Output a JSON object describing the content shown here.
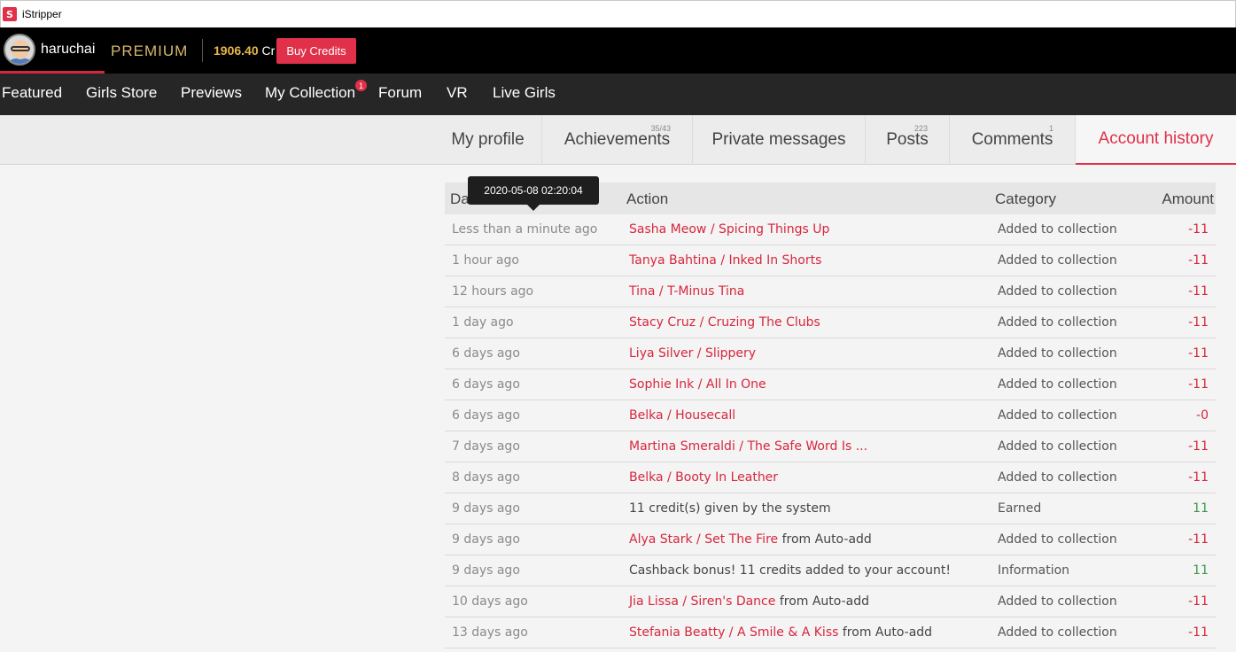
{
  "window": {
    "title": "iStripper",
    "app_icon": "istripper-logo-icon"
  },
  "user": {
    "name": "haruchai",
    "tier": "PREMIUM",
    "credits_value": "1906.40",
    "credits_unit": "Cr",
    "buy_label": "Buy Credits"
  },
  "nav": {
    "items": [
      "Featured",
      "Girls Store",
      "Previews",
      "My Collection",
      "Forum",
      "VR",
      "Live Girls"
    ],
    "collection_badge": "1"
  },
  "tabs": {
    "profile": "My profile",
    "achievements": "Achievements",
    "achievements_count": "35/43",
    "messages": "Private messages",
    "posts": "Posts",
    "posts_count": "223",
    "comments": "Comments",
    "comments_count": "1",
    "history": "Account history"
  },
  "table": {
    "headers": {
      "date": "Da",
      "action": "Action",
      "category": "Category",
      "amount": "Amount"
    },
    "tooltip": "2020-05-08 02:20:04",
    "rows": [
      {
        "date": "Less than a minute ago",
        "link": "Sasha Meow / Spicing Things Up",
        "suffix": "",
        "text": "",
        "category": "Added to collection",
        "amount": "-11",
        "type": "neg"
      },
      {
        "date": "1 hour ago",
        "link": "Tanya Bahtina / Inked In Shorts",
        "suffix": "",
        "text": "",
        "category": "Added to collection",
        "amount": "-11",
        "type": "neg"
      },
      {
        "date": "12 hours ago",
        "link": "Tina / T-Minus Tina",
        "suffix": "",
        "text": "",
        "category": "Added to collection",
        "amount": "-11",
        "type": "neg"
      },
      {
        "date": "1 day ago",
        "link": "Stacy Cruz / Cruzing The Clubs",
        "suffix": "",
        "text": "",
        "category": "Added to collection",
        "amount": "-11",
        "type": "neg"
      },
      {
        "date": "6 days ago",
        "link": "Liya Silver / Slippery",
        "suffix": "",
        "text": "",
        "category": "Added to collection",
        "amount": "-11",
        "type": "neg"
      },
      {
        "date": "6 days ago",
        "link": "Sophie Ink / All In One",
        "suffix": "",
        "text": "",
        "category": "Added to collection",
        "amount": "-11",
        "type": "neg"
      },
      {
        "date": "6 days ago",
        "link": "Belka / Housecall",
        "suffix": "",
        "text": "",
        "category": "Added to collection",
        "amount": "-0",
        "type": "neg"
      },
      {
        "date": "7 days ago",
        "link": "Martina Smeraldi / The Safe Word Is ...",
        "suffix": "",
        "text": "",
        "category": "Added to collection",
        "amount": "-11",
        "type": "neg"
      },
      {
        "date": "8 days ago",
        "link": "Belka / Booty In Leather",
        "suffix": "",
        "text": "",
        "category": "Added to collection",
        "amount": "-11",
        "type": "neg"
      },
      {
        "date": "9 days ago",
        "link": "",
        "suffix": "",
        "text": "11 credit(s) given by the system",
        "category": "Earned",
        "amount": "11",
        "type": "pos"
      },
      {
        "date": "9 days ago",
        "link": "Alya Stark / Set The Fire",
        "suffix": " from Auto-add",
        "text": "",
        "category": "Added to collection",
        "amount": "-11",
        "type": "neg"
      },
      {
        "date": "9 days ago",
        "link": "",
        "suffix": "",
        "text": "Cashback bonus! 11 credits added to your account!",
        "category": "Information",
        "amount": "11",
        "type": "pos"
      },
      {
        "date": "10 days ago",
        "link": "Jia Lissa / Siren's Dance",
        "suffix": " from Auto-add",
        "text": "",
        "category": "Added to collection",
        "amount": "-11",
        "type": "neg"
      },
      {
        "date": "13 days ago",
        "link": "Stefania Beatty / A Smile & A Kiss",
        "suffix": " from Auto-add",
        "text": "",
        "category": "Added to collection",
        "amount": "-11",
        "type": "neg"
      }
    ]
  }
}
